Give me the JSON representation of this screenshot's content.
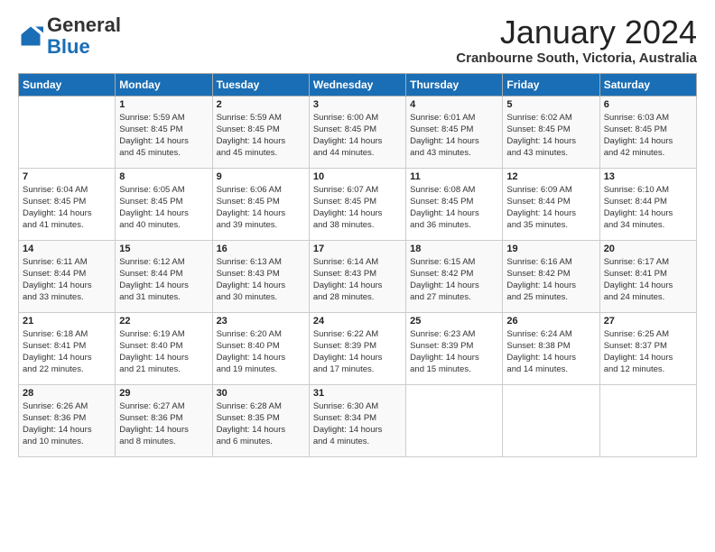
{
  "logo": {
    "general": "General",
    "blue": "Blue"
  },
  "header": {
    "title": "January 2024",
    "subtitle": "Cranbourne South, Victoria, Australia"
  },
  "weekdays": [
    "Sunday",
    "Monday",
    "Tuesday",
    "Wednesday",
    "Thursday",
    "Friday",
    "Saturday"
  ],
  "weeks": [
    [
      {
        "day": "",
        "info": ""
      },
      {
        "day": "1",
        "info": "Sunrise: 5:59 AM\nSunset: 8:45 PM\nDaylight: 14 hours\nand 45 minutes."
      },
      {
        "day": "2",
        "info": "Sunrise: 5:59 AM\nSunset: 8:45 PM\nDaylight: 14 hours\nand 45 minutes."
      },
      {
        "day": "3",
        "info": "Sunrise: 6:00 AM\nSunset: 8:45 PM\nDaylight: 14 hours\nand 44 minutes."
      },
      {
        "day": "4",
        "info": "Sunrise: 6:01 AM\nSunset: 8:45 PM\nDaylight: 14 hours\nand 43 minutes."
      },
      {
        "day": "5",
        "info": "Sunrise: 6:02 AM\nSunset: 8:45 PM\nDaylight: 14 hours\nand 43 minutes."
      },
      {
        "day": "6",
        "info": "Sunrise: 6:03 AM\nSunset: 8:45 PM\nDaylight: 14 hours\nand 42 minutes."
      }
    ],
    [
      {
        "day": "7",
        "info": "Sunrise: 6:04 AM\nSunset: 8:45 PM\nDaylight: 14 hours\nand 41 minutes."
      },
      {
        "day": "8",
        "info": "Sunrise: 6:05 AM\nSunset: 8:45 PM\nDaylight: 14 hours\nand 40 minutes."
      },
      {
        "day": "9",
        "info": "Sunrise: 6:06 AM\nSunset: 8:45 PM\nDaylight: 14 hours\nand 39 minutes."
      },
      {
        "day": "10",
        "info": "Sunrise: 6:07 AM\nSunset: 8:45 PM\nDaylight: 14 hours\nand 38 minutes."
      },
      {
        "day": "11",
        "info": "Sunrise: 6:08 AM\nSunset: 8:45 PM\nDaylight: 14 hours\nand 36 minutes."
      },
      {
        "day": "12",
        "info": "Sunrise: 6:09 AM\nSunset: 8:44 PM\nDaylight: 14 hours\nand 35 minutes."
      },
      {
        "day": "13",
        "info": "Sunrise: 6:10 AM\nSunset: 8:44 PM\nDaylight: 14 hours\nand 34 minutes."
      }
    ],
    [
      {
        "day": "14",
        "info": "Sunrise: 6:11 AM\nSunset: 8:44 PM\nDaylight: 14 hours\nand 33 minutes."
      },
      {
        "day": "15",
        "info": "Sunrise: 6:12 AM\nSunset: 8:44 PM\nDaylight: 14 hours\nand 31 minutes."
      },
      {
        "day": "16",
        "info": "Sunrise: 6:13 AM\nSunset: 8:43 PM\nDaylight: 14 hours\nand 30 minutes."
      },
      {
        "day": "17",
        "info": "Sunrise: 6:14 AM\nSunset: 8:43 PM\nDaylight: 14 hours\nand 28 minutes."
      },
      {
        "day": "18",
        "info": "Sunrise: 6:15 AM\nSunset: 8:42 PM\nDaylight: 14 hours\nand 27 minutes."
      },
      {
        "day": "19",
        "info": "Sunrise: 6:16 AM\nSunset: 8:42 PM\nDaylight: 14 hours\nand 25 minutes."
      },
      {
        "day": "20",
        "info": "Sunrise: 6:17 AM\nSunset: 8:41 PM\nDaylight: 14 hours\nand 24 minutes."
      }
    ],
    [
      {
        "day": "21",
        "info": "Sunrise: 6:18 AM\nSunset: 8:41 PM\nDaylight: 14 hours\nand 22 minutes."
      },
      {
        "day": "22",
        "info": "Sunrise: 6:19 AM\nSunset: 8:40 PM\nDaylight: 14 hours\nand 21 minutes."
      },
      {
        "day": "23",
        "info": "Sunrise: 6:20 AM\nSunset: 8:40 PM\nDaylight: 14 hours\nand 19 minutes."
      },
      {
        "day": "24",
        "info": "Sunrise: 6:22 AM\nSunset: 8:39 PM\nDaylight: 14 hours\nand 17 minutes."
      },
      {
        "day": "25",
        "info": "Sunrise: 6:23 AM\nSunset: 8:39 PM\nDaylight: 14 hours\nand 15 minutes."
      },
      {
        "day": "26",
        "info": "Sunrise: 6:24 AM\nSunset: 8:38 PM\nDaylight: 14 hours\nand 14 minutes."
      },
      {
        "day": "27",
        "info": "Sunrise: 6:25 AM\nSunset: 8:37 PM\nDaylight: 14 hours\nand 12 minutes."
      }
    ],
    [
      {
        "day": "28",
        "info": "Sunrise: 6:26 AM\nSunset: 8:36 PM\nDaylight: 14 hours\nand 10 minutes."
      },
      {
        "day": "29",
        "info": "Sunrise: 6:27 AM\nSunset: 8:36 PM\nDaylight: 14 hours\nand 8 minutes."
      },
      {
        "day": "30",
        "info": "Sunrise: 6:28 AM\nSunset: 8:35 PM\nDaylight: 14 hours\nand 6 minutes."
      },
      {
        "day": "31",
        "info": "Sunrise: 6:30 AM\nSunset: 8:34 PM\nDaylight: 14 hours\nand 4 minutes."
      },
      {
        "day": "",
        "info": ""
      },
      {
        "day": "",
        "info": ""
      },
      {
        "day": "",
        "info": ""
      }
    ]
  ]
}
